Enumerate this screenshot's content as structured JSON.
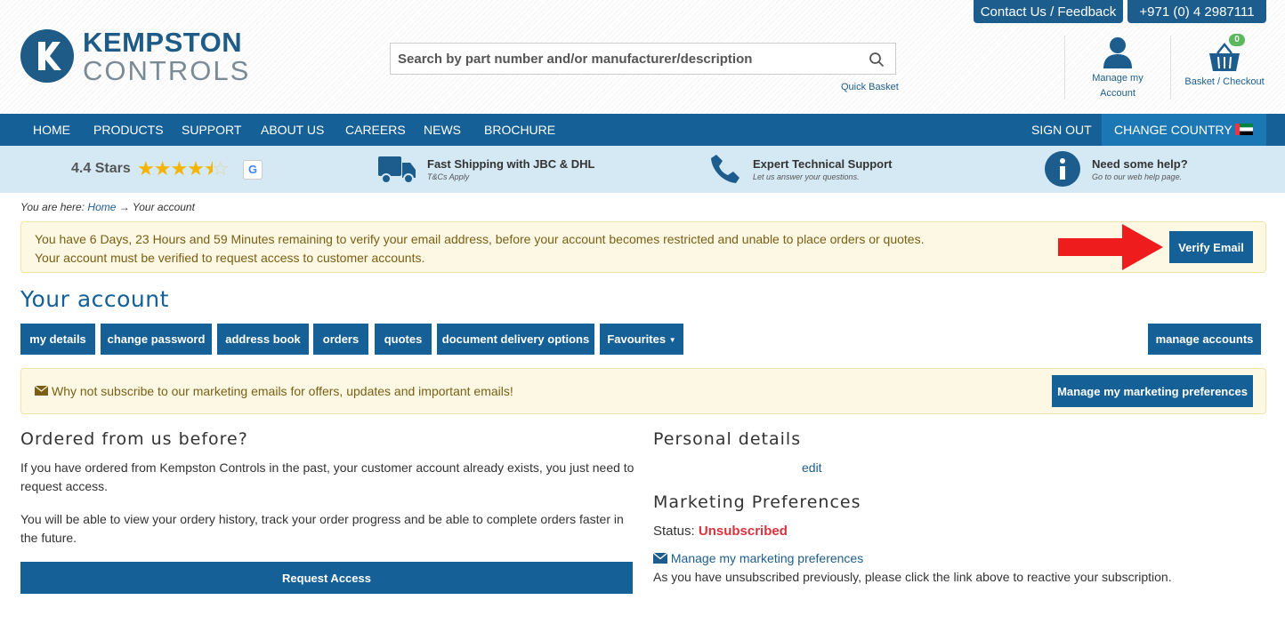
{
  "header": {
    "logo_line1": "KEMPSTON",
    "logo_line2": "CONTROLS",
    "contact_button": "Contact Us / Feedback",
    "phone_button": "+971 (0) 4 2987111",
    "search_placeholder": "Search by part number and/or manufacturer/description",
    "quick_basket": "Quick Basket",
    "account_label_1": "Manage my",
    "account_label_2": "Account",
    "basket_label": "Basket / Checkout",
    "basket_count": "0"
  },
  "nav": {
    "items": [
      "HOME",
      "PRODUCTS",
      "SUPPORT",
      "ABOUT US",
      "CAREERS",
      "NEWS",
      "BROCHURE"
    ],
    "sign_out": "SIGN OUT",
    "change_country": "CHANGE COUNTRY"
  },
  "infobar": {
    "rating": "4.4 Stars",
    "rating_value": 4.4,
    "shipping_title": "Fast Shipping with JBC & DHL",
    "shipping_sub": "T&Cs Apply",
    "support_title": "Expert Technical Support",
    "support_sub": "Let us answer your questions.",
    "help_title": "Need some help?",
    "help_sub": "Go to our web help page."
  },
  "breadcrumb": {
    "prefix": "You are here:",
    "home": "Home",
    "current": "→ Your account"
  },
  "verify_alert": {
    "line1": "You have 6 Days, 23 Hours and 59 Minutes remaining to verify your email address, before your account becomes restricted and unable to place orders or quotes.",
    "line2": "Your account must be verified to request access to customer accounts.",
    "button": "Verify Email"
  },
  "page_title": "Your account",
  "tabs": [
    "my details",
    "change password",
    "address book",
    "orders",
    "quotes",
    "document delivery options",
    "Favourites"
  ],
  "manage_accounts": "manage accounts",
  "promo": {
    "text": "Why not subscribe to our marketing emails for offers, updates and important emails!",
    "button": "Manage my marketing preferences"
  },
  "ordered": {
    "title": "Ordered from us before?",
    "para1": "If you have ordered from Kempston Controls in the past, your customer account already exists, you just need to request access.",
    "para2": "You will be able to view your ordery history, track your order progress and be able to complete orders faster in the future.",
    "button": "Request Access"
  },
  "personal": {
    "title": "Personal details",
    "edit": "edit"
  },
  "marketing": {
    "title": "Marketing Preferences",
    "status_label": "Status:",
    "status_value": "Unsubscribed",
    "status_color": "#d9333f",
    "link": "Manage my marketing preferences",
    "note": "As you have unsubscribed previously, please click the link above to reactive your subscription."
  },
  "colors": {
    "brand_blue": "#146097",
    "nav_active": "#1c78b4",
    "info_bg": "#d5e9f5",
    "alert_bg": "#fdf8e3",
    "arrow_red": "#ee1c1c",
    "star": "#f4b400"
  }
}
